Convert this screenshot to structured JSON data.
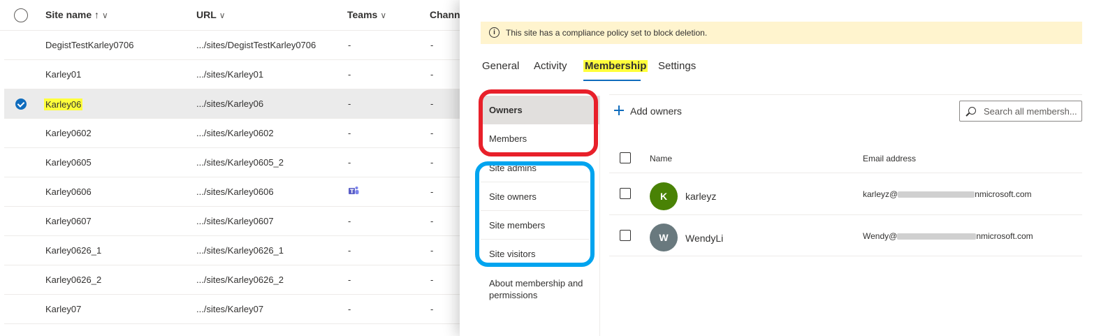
{
  "list": {
    "columns": {
      "site_name": "Site name ↑",
      "url": "URL",
      "teams": "Teams",
      "channel": "Channe"
    },
    "rows": [
      {
        "name": "DegistTestKarley0706",
        "url": ".../sites/DegistTestKarley0706",
        "teams": "-",
        "channel": "-"
      },
      {
        "name": "Karley01",
        "url": ".../sites/Karley01",
        "teams": "-",
        "channel": "-"
      },
      {
        "name": "Karley06",
        "url": ".../sites/Karley06",
        "teams": "-",
        "channel": "-"
      },
      {
        "name": "Karley0602",
        "url": ".../sites/Karley0602",
        "teams": "-",
        "channel": "-"
      },
      {
        "name": "Karley0605",
        "url": ".../sites/Karley0605_2",
        "teams": "-",
        "channel": "-"
      },
      {
        "name": "Karley0606",
        "url": ".../sites/Karley0606",
        "teams": "",
        "channel": "-"
      },
      {
        "name": "Karley0607",
        "url": ".../sites/Karley0607",
        "teams": "-",
        "channel": "-"
      },
      {
        "name": "Karley0626_1",
        "url": ".../sites/Karley0626_1",
        "teams": "-",
        "channel": "-"
      },
      {
        "name": "Karley0626_2",
        "url": ".../sites/Karley0626_2",
        "teams": "-",
        "channel": "-"
      },
      {
        "name": "Karley07",
        "url": ".../sites/Karley07",
        "teams": "-",
        "channel": "-"
      }
    ],
    "selected_row": "Karley06"
  },
  "panel": {
    "banner": "This site has a compliance policy set to block deletion.",
    "tabs": [
      "General",
      "Activity",
      "Membership",
      "Settings"
    ],
    "active_tab": "Membership",
    "subnav": [
      "Owners",
      "Members",
      "Site admins",
      "Site owners",
      "Site members",
      "Site visitors",
      "About membership and permissions"
    ],
    "active_subnav": "Owners",
    "add_button": "Add owners",
    "search_placeholder": "Search all membersh...",
    "table_headers": {
      "name": "Name",
      "email": "Email address"
    },
    "members": [
      {
        "initial": "K",
        "name": "karleyz",
        "email_start": "karleyz@",
        "email_end": "nmicrosoft.com",
        "color": "#498205"
      },
      {
        "initial": "W",
        "name": "WendyLi",
        "email_start": "Wendy@",
        "email_end": "nmicrosoft.com",
        "color": "#69797e"
      }
    ]
  },
  "colors": {
    "accent": "#0f6cbd",
    "highlight": "#ffff3b",
    "annotation_red": "#e8202a",
    "annotation_blue": "#00a4ef"
  }
}
